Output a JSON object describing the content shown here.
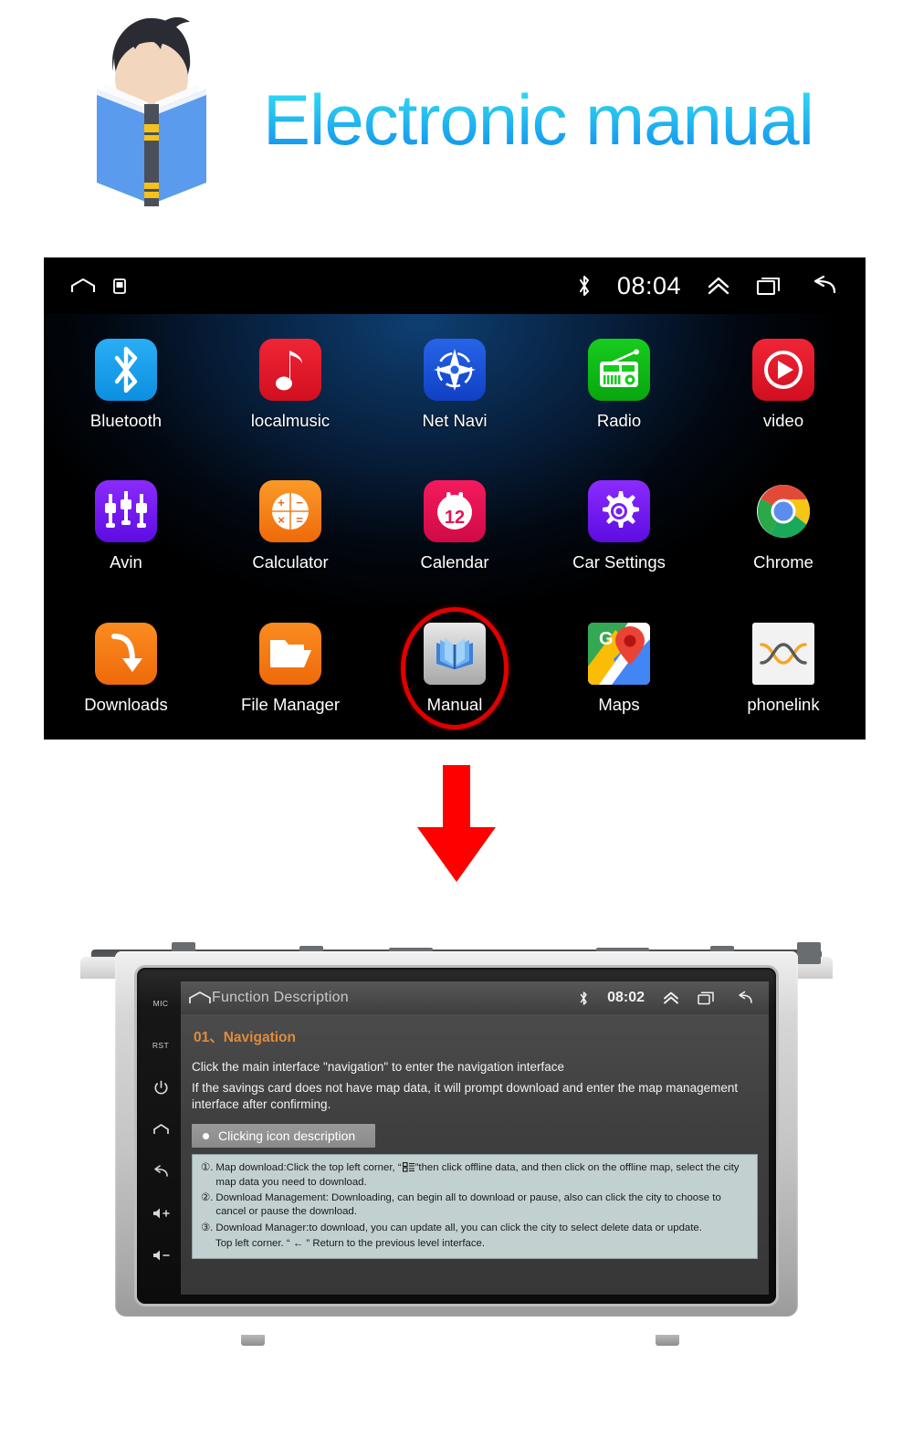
{
  "header": {
    "title": "Electronic manual",
    "mascot_icon": "person-reading-book-icon"
  },
  "android_screen": {
    "status_bar": {
      "home_icon": "home-icon",
      "screenshot_icon": "screenshot-icon",
      "bluetooth_icon": "bluetooth-icon",
      "time": "08:04",
      "expand_icon": "double-chevron-up-icon",
      "recents_icon": "recent-apps-icon",
      "back_icon": "back-arrow-icon"
    },
    "apps": [
      {
        "label": "Bluetooth",
        "icon": "bluetooth-icon",
        "color": "#1fa2f0"
      },
      {
        "label": "localmusic",
        "icon": "music-note-icon",
        "color": "#e81f2d"
      },
      {
        "label": "Net Navi",
        "icon": "compass-icon",
        "color": "#1b56d6"
      },
      {
        "label": "Radio",
        "icon": "radio-icon",
        "color": "#12bf1d"
      },
      {
        "label": "video",
        "icon": "play-circle-icon",
        "color": "#e81f2d"
      },
      {
        "label": "Avin",
        "icon": "av-plugs-icon",
        "color": "#7a1ff0"
      },
      {
        "label": "Calculator",
        "icon": "calculator-icon",
        "color": "#f07a18"
      },
      {
        "label": "Calendar",
        "icon": "calendar-12-icon",
        "color": "#ea1155"
      },
      {
        "label": "Car Settings",
        "icon": "gear-icon",
        "color": "#7a1ff0"
      },
      {
        "label": "Chrome",
        "icon": "chrome-icon",
        "color": "#ffffff"
      },
      {
        "label": "Downloads",
        "icon": "download-arrow-icon",
        "color": "#f2711c"
      },
      {
        "label": "File Manager",
        "icon": "folder-icon",
        "color": "#f2711c"
      },
      {
        "label": "Manual",
        "icon": "open-book-icon",
        "color": "#c9c9c9",
        "highlighted": true
      },
      {
        "label": "Maps",
        "icon": "google-maps-icon",
        "color": "#ffffff"
      },
      {
        "label": "phonelink",
        "icon": "phonelink-x-icon",
        "color": "#f2f2f2"
      }
    ],
    "highlight_color": "#e00000"
  },
  "arrow": {
    "icon": "down-arrow-icon",
    "color": "#ff0000"
  },
  "car_unit": {
    "side_buttons": [
      "MIC",
      "RST",
      "power-icon",
      "home-icon",
      "back-icon",
      "volume-up-icon",
      "volume-down-icon"
    ],
    "side_button_labels": {
      "mic": "MIC",
      "rst": "RST"
    },
    "screen": {
      "status_bar": {
        "home_icon": "home-icon",
        "title": "Function Description",
        "bluetooth_icon": "bluetooth-icon",
        "time": "08:02",
        "expand_icon": "double-chevron-up-icon",
        "recents_icon": "recent-apps-icon",
        "back_icon": "back-arrow-icon"
      },
      "section_title": "01、Navigation",
      "paragraphs": [
        "Click the main interface \"navigation\" to enter the navigation interface",
        "If the savings card does not have map data, it will prompt download and enter the map management interface after confirming."
      ],
      "bullet_heading": "Clicking icon description",
      "notes": [
        {
          "num": "①.",
          "text_before": "Map download:Click the top left corner, “",
          "inline_icon": "list-grid-icon",
          "text_after": "”then click offline data, and then click on the offline map, select the city map data you need to download."
        },
        {
          "num": "②.",
          "text_before": "Download Management: Downloading, can begin all to download or pause, also can click the city to choose to cancel or pause the download.",
          "inline_icon": "",
          "text_after": ""
        },
        {
          "num": "③.",
          "text_before": "Download Manager:to download, you can update all, you can click the city to select delete data or update.",
          "inline_icon": "",
          "text_after": ""
        }
      ],
      "footer_note": "Top left corner. “ ← ” Return to the previous level interface."
    }
  }
}
